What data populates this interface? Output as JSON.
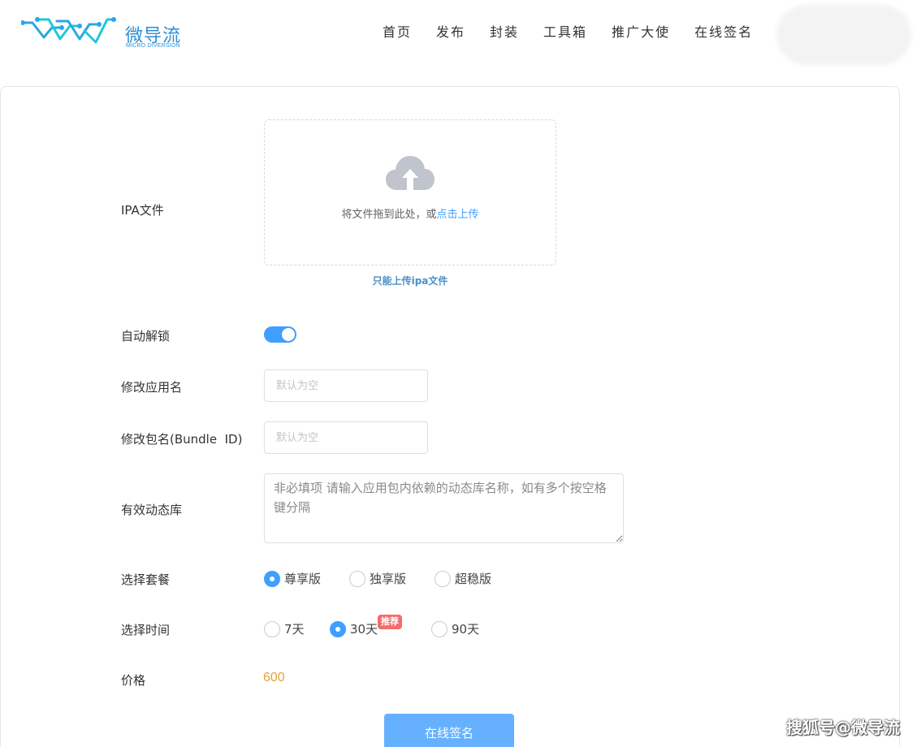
{
  "brand": {
    "name": "微导流",
    "subtitle": "MICRO DIVERSION",
    "color": "#2d8fd5"
  },
  "nav": {
    "items": [
      "首页",
      "发布",
      "封装",
      "工具箱",
      "推广大使",
      "在线签名"
    ]
  },
  "form": {
    "ipa": {
      "label": "IPA文件",
      "drop_text": "将文件拖到此处，或",
      "link_text": "点击上传",
      "tip": "只能上传ipa文件",
      "icon": "upload-cloud-icon"
    },
    "auto_unlock": {
      "label": "自动解锁",
      "enabled": true
    },
    "app_name": {
      "label": "修改应用名",
      "placeholder": "默认为空",
      "value": ""
    },
    "bundle_id": {
      "label": "修改包名(Bundle  ID)",
      "placeholder": "默认为空",
      "value": ""
    },
    "dylib": {
      "label": "有效动态库",
      "placeholder": "非必填项 请输入应用包内依赖的动态库名称，如有多个按空格键分隔",
      "value": ""
    },
    "plan": {
      "label": "选择套餐",
      "options": [
        "尊享版",
        "独享版",
        "超稳版"
      ],
      "selected": "尊享版"
    },
    "duration": {
      "label": "选择时间",
      "options": [
        "7天",
        "30天",
        "90天"
      ],
      "selected": "30天",
      "badge": "推荐"
    },
    "price": {
      "label": "价格",
      "value": "600"
    },
    "submit_label": "在线签名"
  },
  "colors": {
    "accent": "#409eff",
    "price": "#e6a23c",
    "badge": "#f56c6c"
  },
  "watermark": "搜狐号@微导流"
}
